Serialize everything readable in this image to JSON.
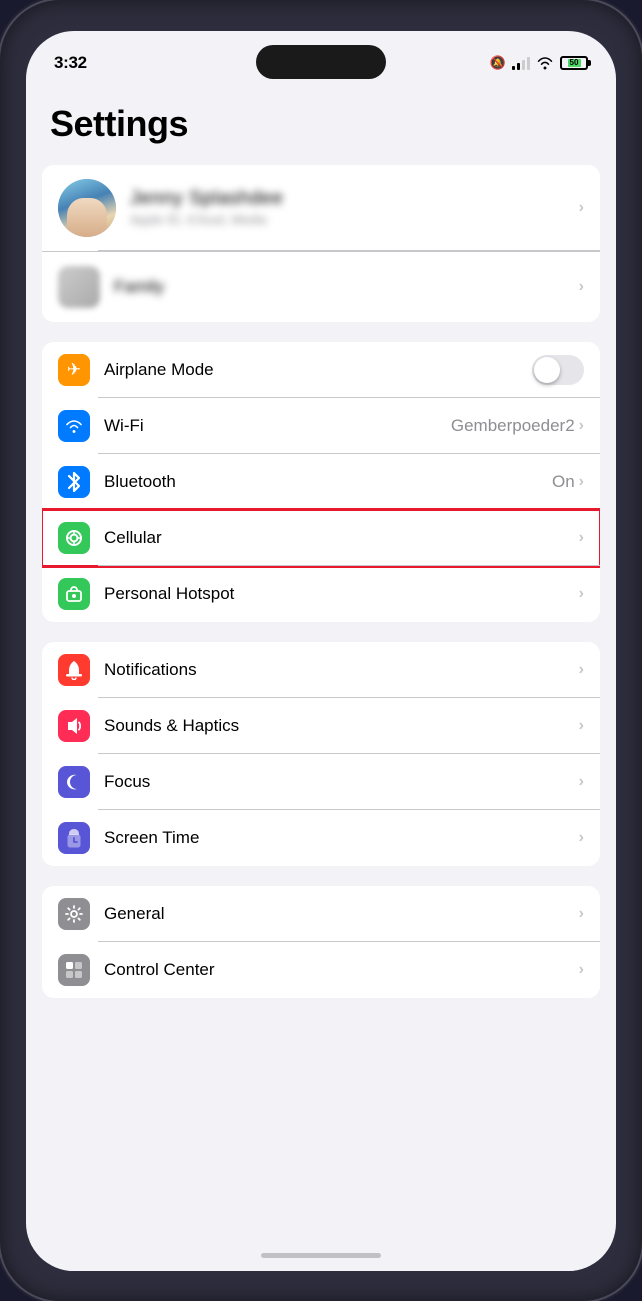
{
  "statusBar": {
    "time": "3:32",
    "battery": "50"
  },
  "page": {
    "title": "Settings"
  },
  "profile": {
    "name": "Jenny Splashdee",
    "subtitle": "Apple ID, iCloud, Media & Purchases",
    "row2label": "Family"
  },
  "settingsGroups": [
    {
      "id": "connectivity",
      "items": [
        {
          "id": "airplane-mode",
          "label": "Airplane Mode",
          "iconBg": "orange",
          "iconSymbol": "✈",
          "type": "toggle",
          "toggleOn": false
        },
        {
          "id": "wifi",
          "label": "Wi-Fi",
          "iconBg": "blue",
          "iconSymbol": "wifi",
          "type": "value",
          "value": "Gemberpoeder2"
        },
        {
          "id": "bluetooth",
          "label": "Bluetooth",
          "iconBg": "blue",
          "iconSymbol": "bluetooth",
          "type": "value",
          "value": "On"
        },
        {
          "id": "cellular",
          "label": "Cellular",
          "iconBg": "green",
          "iconSymbol": "cellular",
          "type": "chevron",
          "highlighted": true
        },
        {
          "id": "personal-hotspot",
          "label": "Personal Hotspot",
          "iconBg": "green",
          "iconSymbol": "hotspot",
          "type": "chevron"
        }
      ]
    },
    {
      "id": "notifications",
      "items": [
        {
          "id": "notifications",
          "label": "Notifications",
          "iconBg": "red",
          "iconSymbol": "bell",
          "type": "chevron"
        },
        {
          "id": "sounds-haptics",
          "label": "Sounds & Haptics",
          "iconBg": "pink-red",
          "iconSymbol": "speaker",
          "type": "chevron"
        },
        {
          "id": "focus",
          "label": "Focus",
          "iconBg": "indigo",
          "iconSymbol": "moon",
          "type": "chevron"
        },
        {
          "id": "screen-time",
          "label": "Screen Time",
          "iconBg": "purple",
          "iconSymbol": "hourglass",
          "type": "chevron"
        }
      ]
    },
    {
      "id": "general",
      "items": [
        {
          "id": "general",
          "label": "General",
          "iconBg": "gray",
          "iconSymbol": "gear",
          "type": "chevron"
        },
        {
          "id": "control-center",
          "label": "Control Center",
          "iconBg": "gray",
          "iconSymbol": "sliders",
          "type": "chevron"
        }
      ]
    }
  ]
}
